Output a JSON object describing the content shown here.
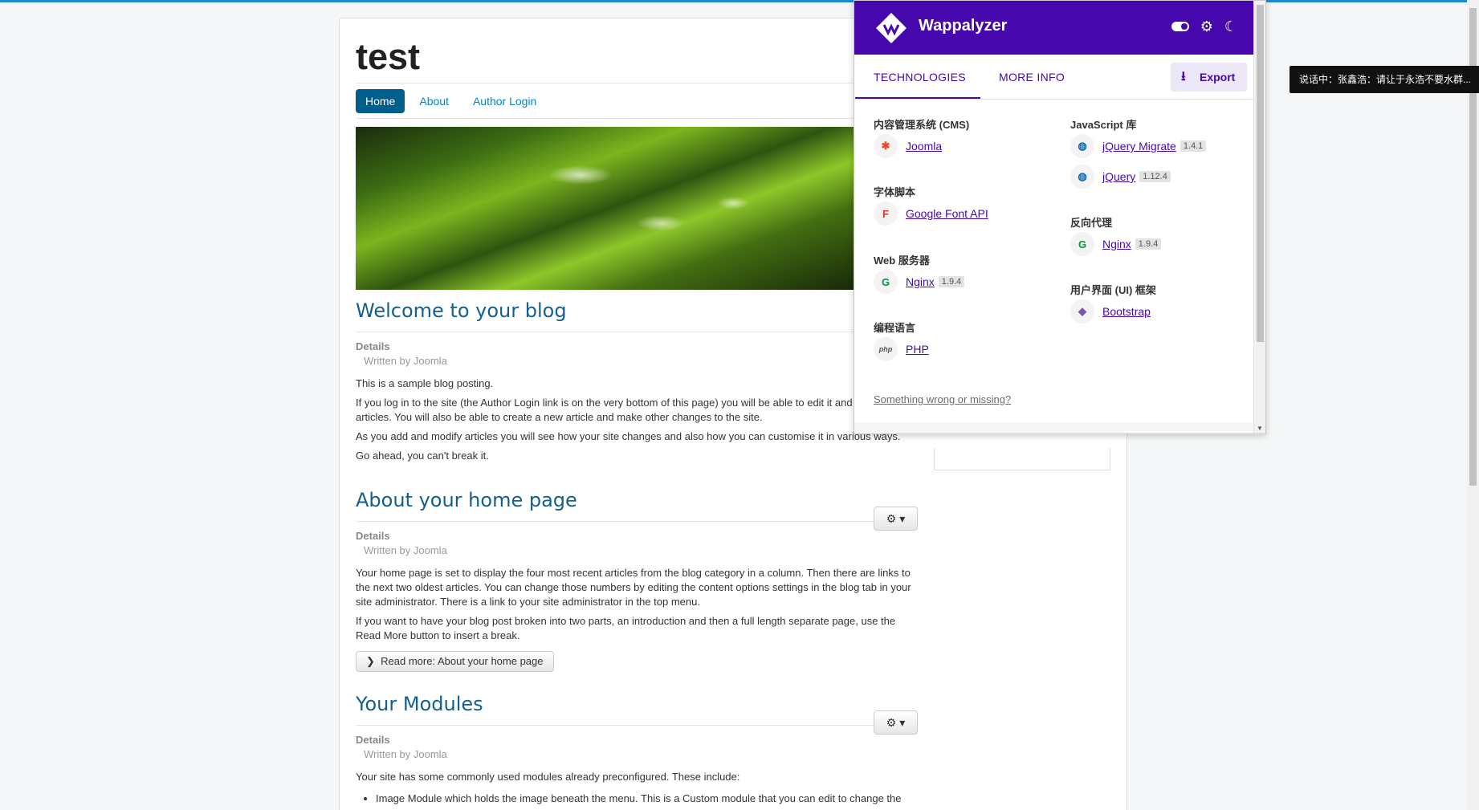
{
  "site": {
    "title": "test",
    "nav": [
      "Home",
      "About",
      "Author Login"
    ],
    "articles": [
      {
        "title": "Welcome to your blog",
        "details_label": "Details",
        "author": "Written by Joomla",
        "paragraphs": [
          "This is a sample blog posting.",
          "If you log in to the site (the Author Login link is on the very bottom of this page) you will be able to edit it and other existing articles. You will also be able to create a new article and make other changes to the site.",
          "As you add and modify articles you will see how your site changes and also how you can customise it in various ways.",
          "Go ahead, you can't break it."
        ]
      },
      {
        "title": "About your home page",
        "details_label": "Details",
        "author": "Written by Joomla",
        "paragraphs": [
          "Your home page is set to display the four most recent articles from the blog category in a column. Then there are links to the next two oldest articles. You can change those numbers by editing the content options settings in the blog tab in your site administrator. There is a link to your site administrator in the top menu.",
          "If you want to have your blog post broken into two parts, an introduction and then a full length separate page, use the Read More button to insert a break."
        ],
        "read_more": "Read more: About your home page"
      },
      {
        "title": "Your Modules",
        "details_label": "Details",
        "author": "Written by Joomla",
        "paragraphs": [
          "Your site has some commonly used modules already preconfigured. These include:"
        ],
        "bullets": [
          "Image Module which holds the image beneath the menu. This is a Custom module that you can edit to change the"
        ]
      }
    ]
  },
  "wappalyzer": {
    "title": "Wappalyzer",
    "tabs": [
      "TECHNOLOGIES",
      "MORE INFO"
    ],
    "export_label": "Export",
    "left_column": [
      {
        "category": "内容管理系统 (CMS)",
        "items": [
          {
            "name": "Joomla",
            "icon": "joomla-icon",
            "glyph": "✱",
            "color": "#e44d26"
          }
        ]
      },
      {
        "category": "字体脚本",
        "items": [
          {
            "name": "Google Font API",
            "icon": "google-font-icon",
            "glyph": "F",
            "color": "#d33"
          }
        ]
      },
      {
        "category": "Web 服务器",
        "items": [
          {
            "name": "Nginx",
            "version": "1.9.4",
            "icon": "nginx-icon",
            "glyph": "G",
            "color": "#009639"
          }
        ]
      },
      {
        "category": "编程语言",
        "items": [
          {
            "name": "PHP",
            "icon": "php-icon",
            "glyph": "php",
            "color": "#555"
          }
        ]
      }
    ],
    "right_column": [
      {
        "category": "JavaScript 库",
        "items": [
          {
            "name": "jQuery Migrate",
            "version": "1.4.1",
            "icon": "jquery-icon",
            "glyph": "◍",
            "color": "#0769ad"
          },
          {
            "name": "jQuery",
            "version": "1.12.4",
            "icon": "jquery-icon",
            "glyph": "◍",
            "color": "#0769ad"
          }
        ]
      },
      {
        "category": "反向代理",
        "items": [
          {
            "name": "Nginx",
            "version": "1.9.4",
            "icon": "nginx-icon",
            "glyph": "G",
            "color": "#009639"
          }
        ]
      },
      {
        "category": "用户界面 (UI) 框架",
        "items": [
          {
            "name": "Bootstrap",
            "icon": "bootstrap-icon",
            "glyph": "◆",
            "color": "#7952b3"
          }
        ]
      }
    ],
    "feedback_link": "Something wrong or missing?"
  },
  "toast": "说话中：张鑫浩：请让于永浩不要水群..."
}
